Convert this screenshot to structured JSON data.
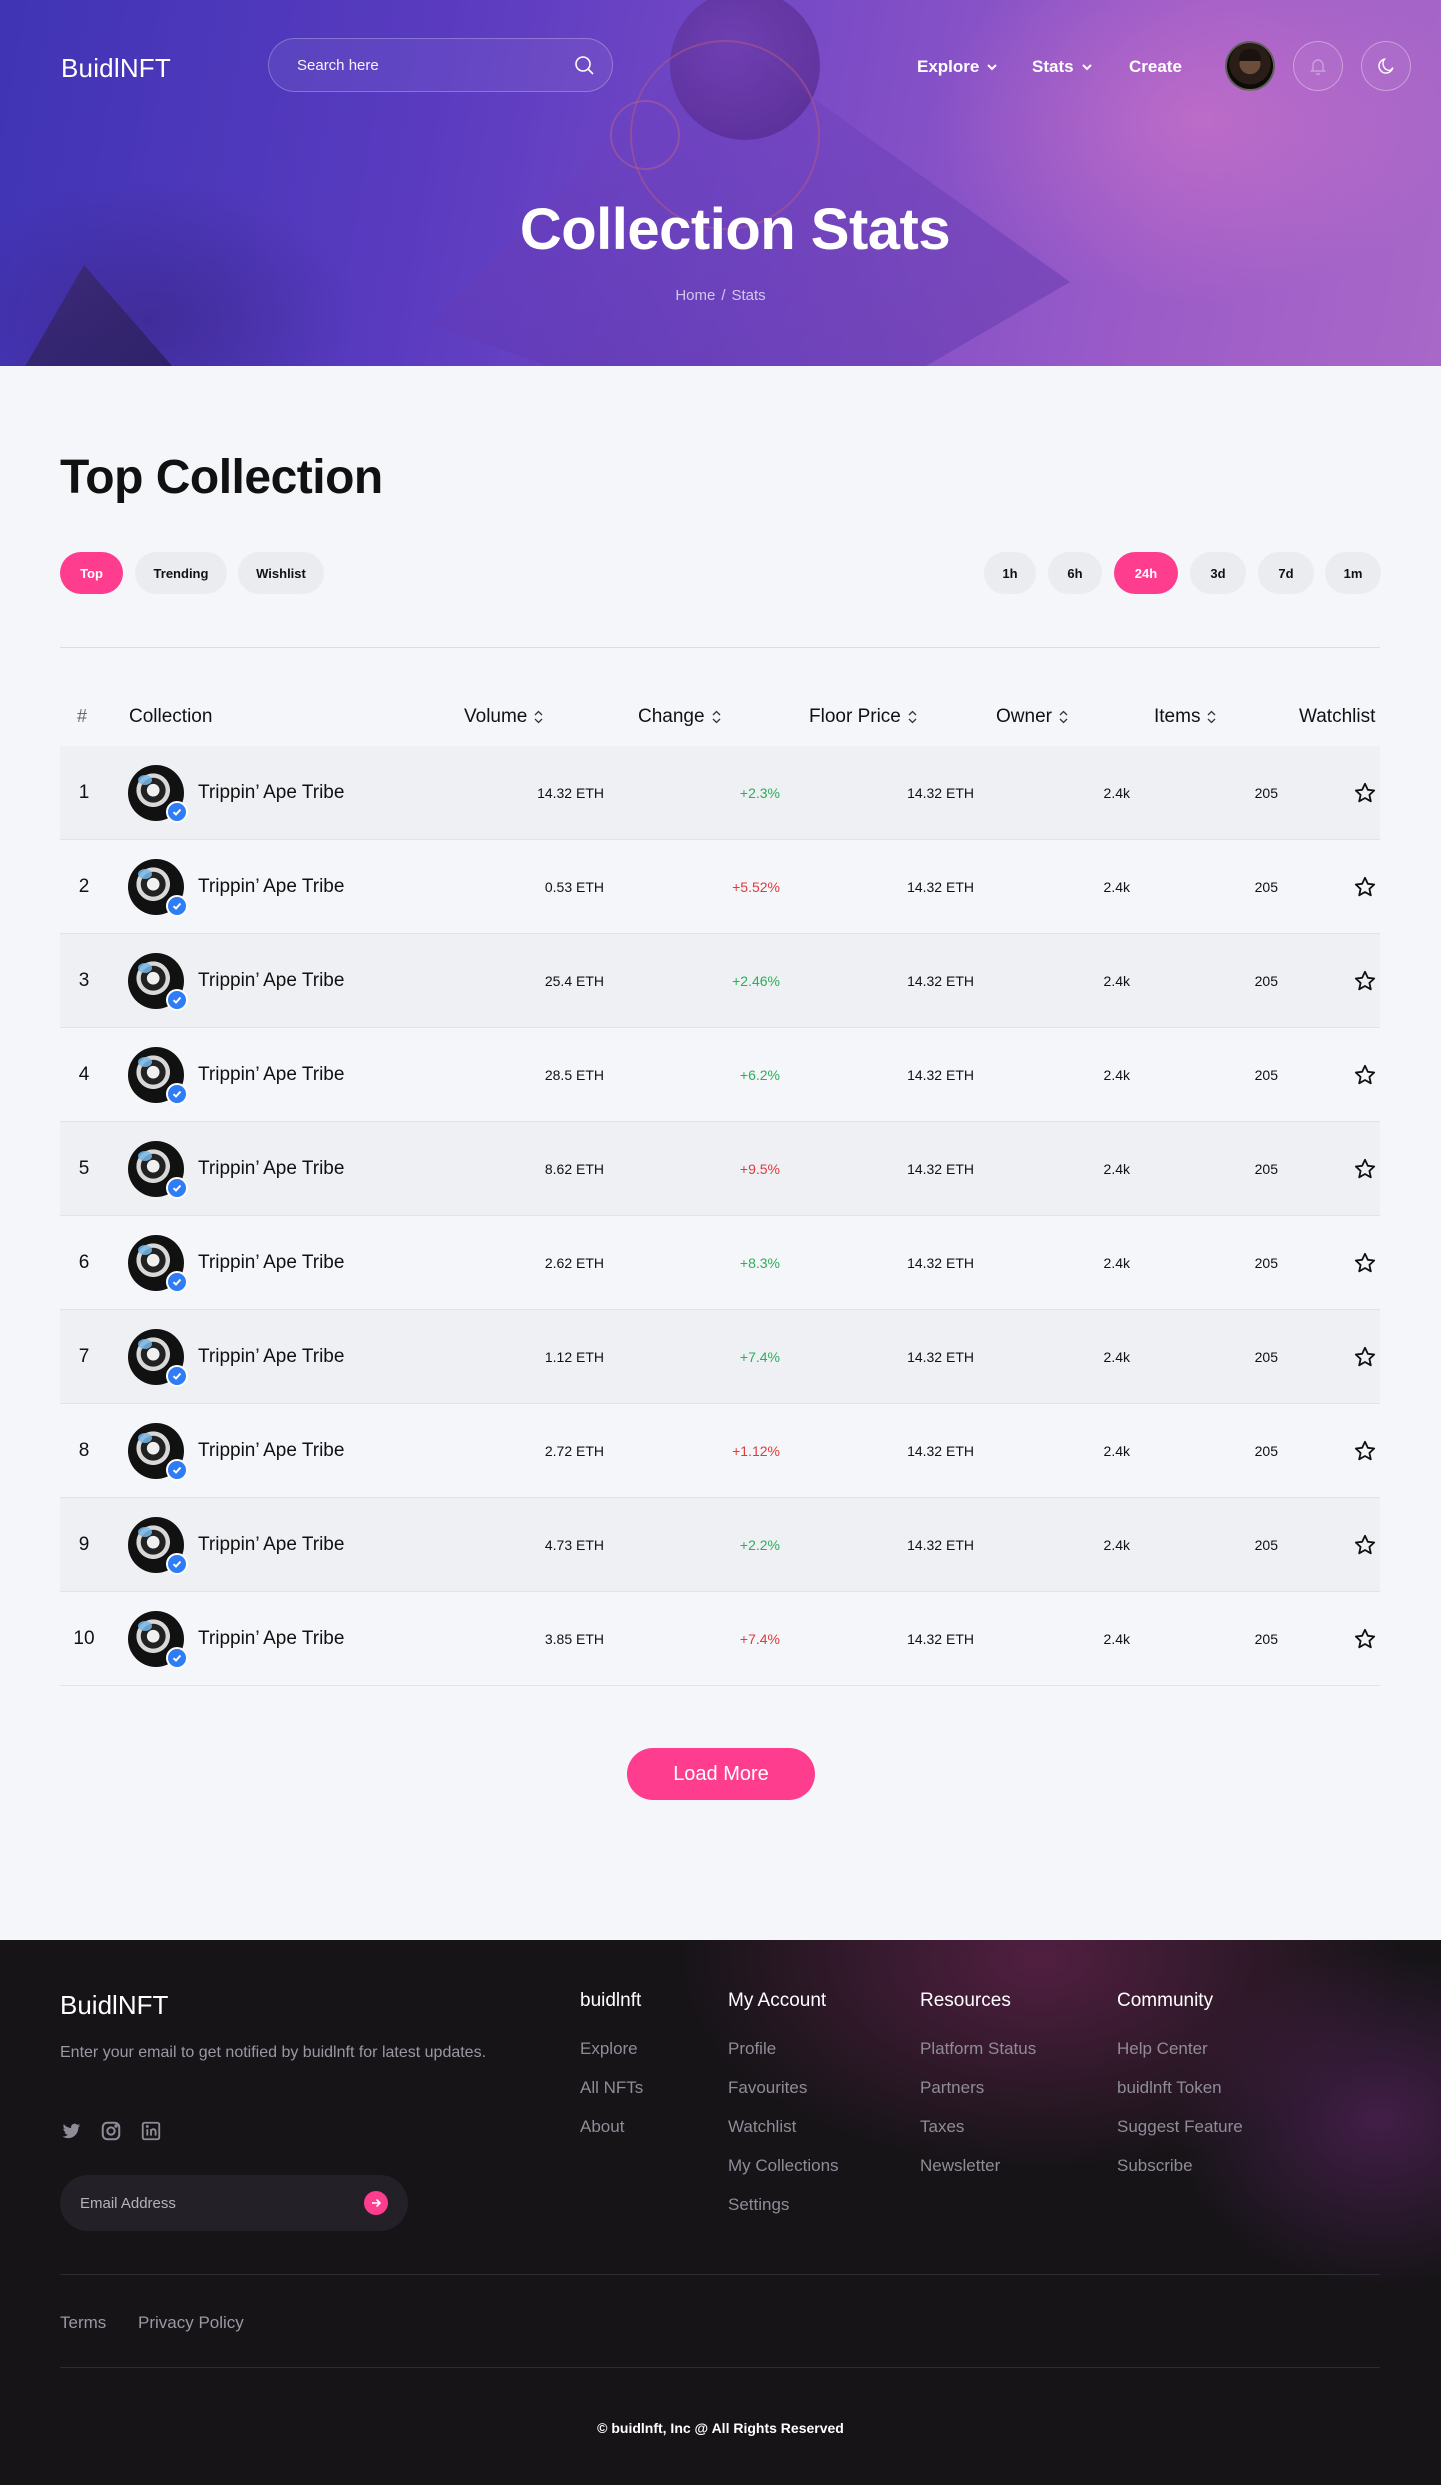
{
  "header": {
    "logo": "BuidlNFT",
    "search_placeholder": "Search here",
    "nav": {
      "explore": "Explore",
      "stats": "Stats",
      "create": "Create"
    }
  },
  "hero": {
    "title": "Collection Stats",
    "breadcrumb": {
      "home": "Home",
      "separator": "/",
      "current": "Stats"
    }
  },
  "main": {
    "title": "Top Collection",
    "tabs": [
      "Top",
      "Trending",
      "Wishlist"
    ],
    "active_tab": "Top",
    "time_filters": [
      "1h",
      "6h",
      "24h",
      "3d",
      "7d",
      "1m"
    ],
    "active_time": "24h",
    "columns": {
      "rank": "#",
      "collection": "Collection",
      "volume": "Volume",
      "change": "Change",
      "floor": "Floor Price",
      "owner": "Owner",
      "items": "Items",
      "watchlist": "Watchlist"
    },
    "rows": [
      {
        "rank": "1",
        "name": "Trippin’ Ape Tribe",
        "volume": "14.32 ETH",
        "change": "+2.3%",
        "trend": "up",
        "floor": "14.32 ETH",
        "owner": "2.4k",
        "items": "205"
      },
      {
        "rank": "2",
        "name": "Trippin’ Ape Tribe",
        "volume": "0.53 ETH",
        "change": "+5.52%",
        "trend": "down",
        "floor": "14.32 ETH",
        "owner": "2.4k",
        "items": "205"
      },
      {
        "rank": "3",
        "name": "Trippin’ Ape Tribe",
        "volume": "25.4 ETH",
        "change": "+2.46%",
        "trend": "up",
        "floor": "14.32 ETH",
        "owner": "2.4k",
        "items": "205"
      },
      {
        "rank": "4",
        "name": "Trippin’ Ape Tribe",
        "volume": "28.5 ETH",
        "change": "+6.2%",
        "trend": "up",
        "floor": "14.32 ETH",
        "owner": "2.4k",
        "items": "205"
      },
      {
        "rank": "5",
        "name": "Trippin’ Ape Tribe",
        "volume": "8.62 ETH",
        "change": "+9.5%",
        "trend": "down",
        "floor": "14.32 ETH",
        "owner": "2.4k",
        "items": "205"
      },
      {
        "rank": "6",
        "name": "Trippin’ Ape Tribe",
        "volume": "2.62 ETH",
        "change": "+8.3%",
        "trend": "up",
        "floor": "14.32 ETH",
        "owner": "2.4k",
        "items": "205"
      },
      {
        "rank": "7",
        "name": "Trippin’ Ape Tribe",
        "volume": "1.12 ETH",
        "change": "+7.4%",
        "trend": "up",
        "floor": "14.32 ETH",
        "owner": "2.4k",
        "items": "205"
      },
      {
        "rank": "8",
        "name": "Trippin’ Ape Tribe",
        "volume": "2.72 ETH",
        "change": "+1.12%",
        "trend": "down",
        "floor": "14.32 ETH",
        "owner": "2.4k",
        "items": "205"
      },
      {
        "rank": "9",
        "name": "Trippin’ Ape Tribe",
        "volume": "4.73 ETH",
        "change": "+2.2%",
        "trend": "up",
        "floor": "14.32 ETH",
        "owner": "2.4k",
        "items": "205"
      },
      {
        "rank": "10",
        "name": "Trippin’ Ape Tribe",
        "volume": "3.85 ETH",
        "change": "+7.4%",
        "trend": "down",
        "floor": "14.32 ETH",
        "owner": "2.4k",
        "items": "205"
      }
    ],
    "load_more": "Load More"
  },
  "footer": {
    "logo": "BuidlNFT",
    "description": "Enter your email to get notified by buidlnft for latest updates.",
    "email_placeholder": "Email Address",
    "columns": [
      {
        "title": "buidlnft",
        "links": [
          "Explore",
          "All NFTs",
          "About"
        ]
      },
      {
        "title": "My Account",
        "links": [
          "Profile",
          "Favourites",
          "Watchlist",
          "My Collections",
          "Settings"
        ]
      },
      {
        "title": "Resources",
        "links": [
          "Platform Status",
          "Partners",
          "Taxes",
          "Newsletter"
        ]
      },
      {
        "title": "Community",
        "links": [
          "Help Center",
          "buidlnft Token",
          "Suggest Feature",
          "Subscribe"
        ]
      }
    ],
    "legal": {
      "terms": "Terms",
      "privacy": "Privacy Policy"
    },
    "copyright": "© buidlnft, Inc @ All Rights Reserved"
  },
  "colors": {
    "accent": "#ff3d8f",
    "positive": "#2cae5a",
    "negative": "#e03a3a",
    "verified": "#2e7cf6"
  },
  "icons": {
    "search": "search-icon",
    "chevron": "chevron-down-icon",
    "bell": "bell-icon",
    "moon": "moon-icon",
    "sort": "sort-icon",
    "star": "star-icon",
    "verified": "verified-badge-icon",
    "twitter": "twitter-icon",
    "instagram": "instagram-icon",
    "linkedin": "linkedin-icon",
    "arrow": "arrow-right-icon"
  }
}
